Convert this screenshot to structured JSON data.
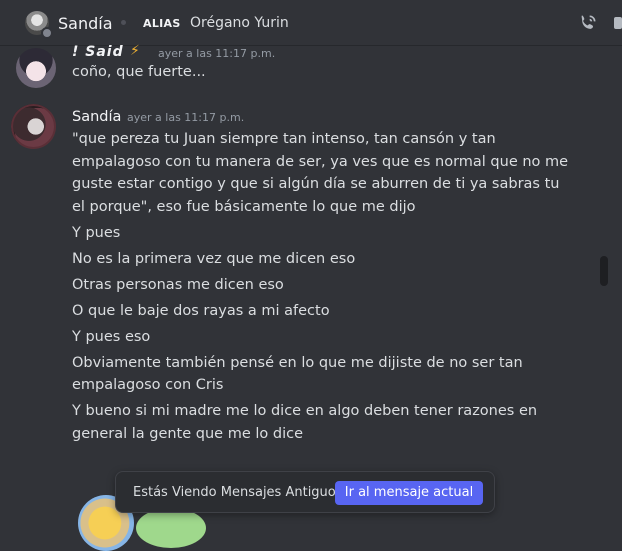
{
  "header": {
    "name": "Sandía",
    "alias_label": "ALIAS",
    "alias_value": "Orégano Yurin",
    "icons": [
      "avatar",
      "call-icon",
      "more-icon"
    ]
  },
  "previous_message": {
    "author": "! Said",
    "badge": "⚡",
    "timestamp": "ayer a las 11:17 p.m.",
    "text": "coño, que fuerte..."
  },
  "message": {
    "author": "Sandía",
    "timestamp": "ayer a las 11:17 p.m.",
    "lines": [
      "\"que pereza tu Juan siempre tan intenso, tan cansón y tan empalagoso con tu manera de ser, ya ves que es normal que no me guste estar contigo y que si algún día se aburren de ti ya sabras tu el porque\", eso fue básicamente lo que me dijo",
      "Y pues",
      "No es la primera vez que me dicen eso",
      "Otras personas me dicen eso",
      "O que le baje dos rayas a mi afecto",
      "Y pues eso",
      "Obviamente también pensé en lo que me dijiste de no ser tan empalagoso con Cris",
      "Y bueno si mi madre me lo dice en algo deben tener razones en general la gente que me lo dice"
    ]
  },
  "banner": {
    "label": "Estás Viendo Mensajes Antiguos",
    "button": "Ir al mensaje actual"
  },
  "colors": {
    "background": "#313338",
    "accent": "#5865f2",
    "text": "#dbdee1",
    "muted": "#949ba4"
  }
}
